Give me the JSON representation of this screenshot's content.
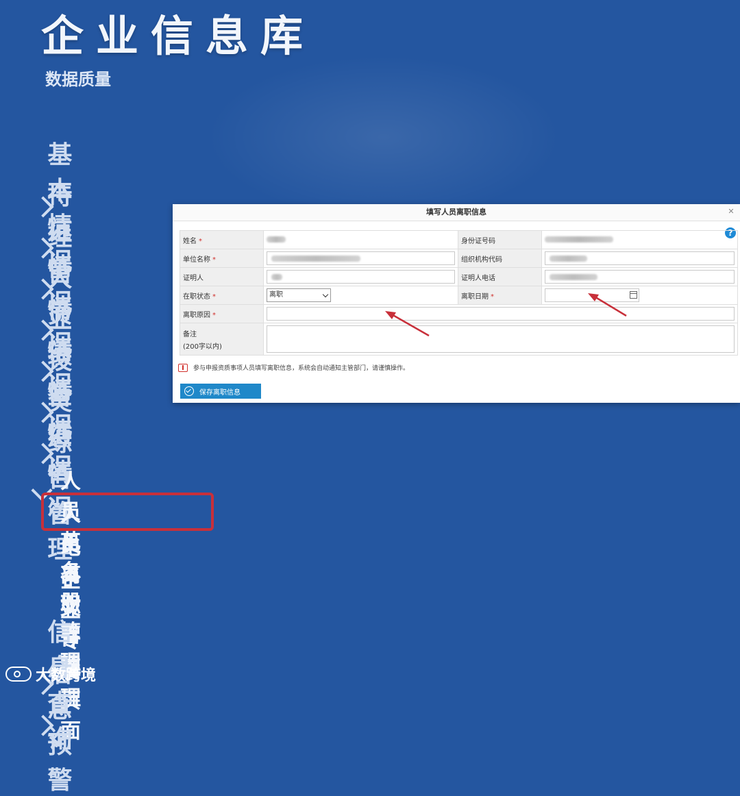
{
  "app": {
    "title": "企业信息库",
    "subtitle": "数据质量"
  },
  "sidebar": {
    "items": [
      {
        "label": "基本情况",
        "expanded": false
      },
      {
        "label": "持证情况",
        "expanded": false
      },
      {
        "label": "经营情况",
        "expanded": false
      },
      {
        "label": "人员情况",
        "expanded": false
      },
      {
        "label": "业绩情况",
        "expanded": false
      },
      {
        "label": "设备情况",
        "expanded": false
      },
      {
        "label": "奖惩情况",
        "expanded": false
      },
      {
        "label": "综合管理",
        "expanded": true,
        "children": [
          "人员花名册管理",
          "人员离职管理",
          "电子文件管理",
          "企业专属页面"
        ]
      },
      {
        "label": "信息查询",
        "expanded": false
      },
      {
        "label": "信息预警",
        "expanded": false
      }
    ],
    "highlighted_child": "人员离职管理"
  },
  "dialog": {
    "title": "填写人员离职信息",
    "fields": {
      "name_label": "姓名",
      "id_label": "身份证号码",
      "company_label": "单位名称",
      "orgcode_label": "组织机构代码",
      "witness_label": "证明人",
      "witness_phone_label": "证明人电话",
      "status_label": "在职状态",
      "status_value": "离职",
      "leave_date_label": "离职日期",
      "leave_reason_label": "离职原因",
      "remark_label": "备注",
      "remark_hint": "(200字以内)"
    },
    "required_mark": "*",
    "notice": "参与申报资质事项人员填写离职信息，系统会自动通知主管部门，请谨慎操作。",
    "save_label": "保存离职信息",
    "help_glyph": "?"
  },
  "watermark": {
    "text": "大数跨境"
  },
  "colors": {
    "background": "#2456a0",
    "highlight": "#c8303a",
    "button": "#1f88c9",
    "required": "#d0302c"
  }
}
